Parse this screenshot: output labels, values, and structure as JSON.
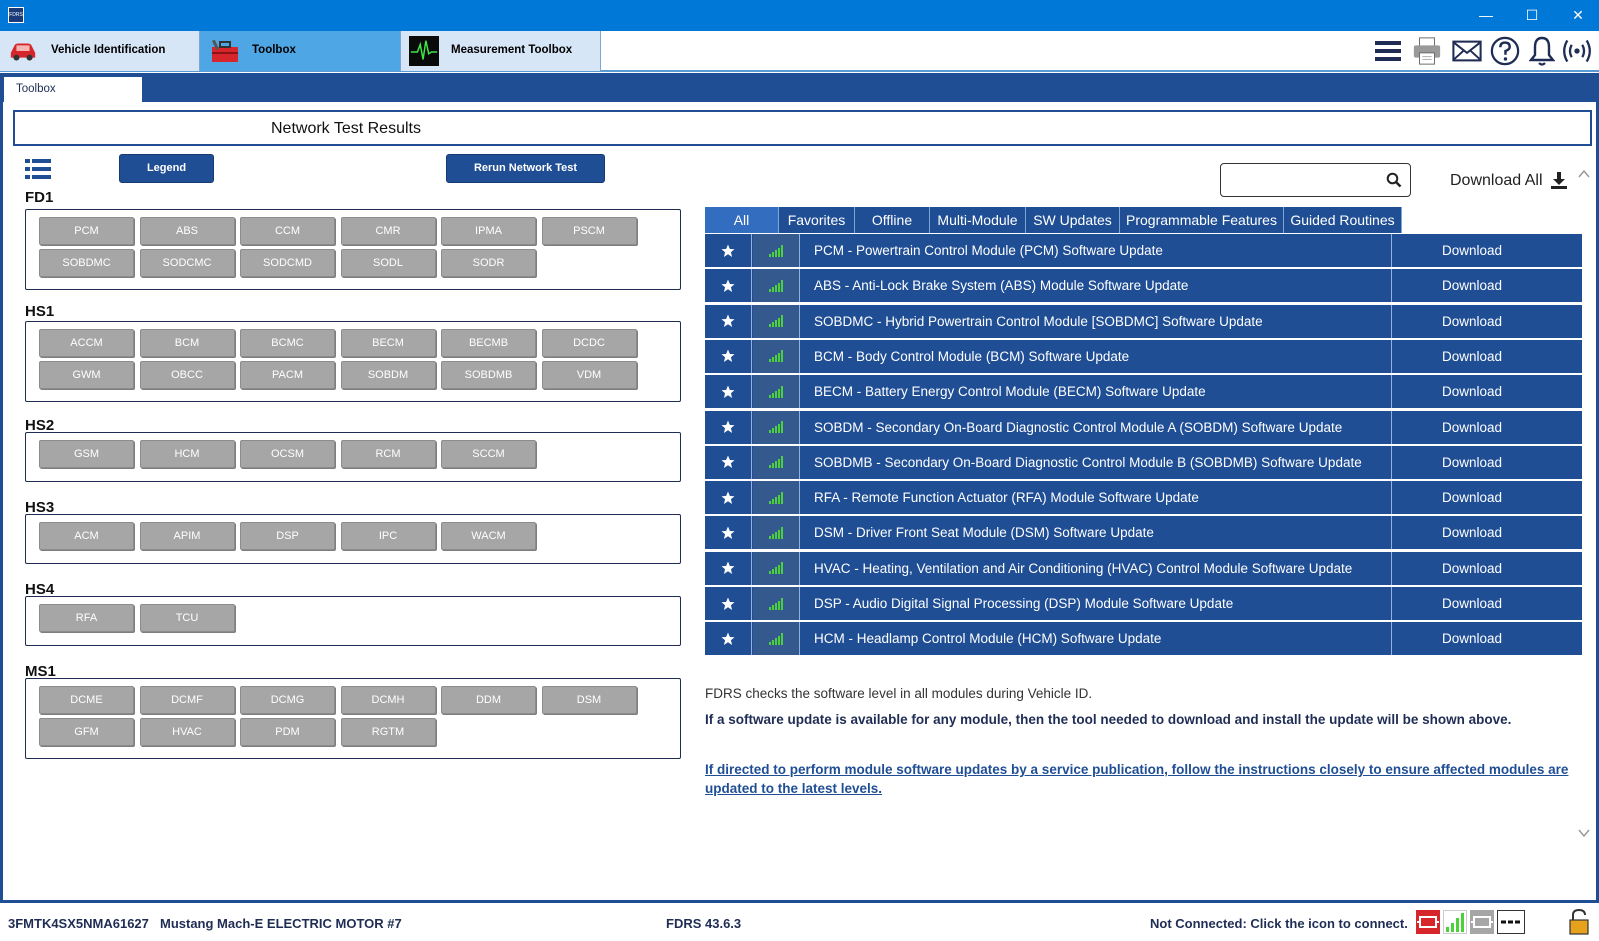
{
  "titlebar": {
    "app_icon": "fdrs-logo-icon",
    "minimize": "—",
    "maximize": "☐",
    "close": "✕"
  },
  "main_tabs": [
    {
      "label": "Vehicle Identification",
      "icon": "car-icon"
    },
    {
      "label": "Toolbox",
      "icon": "toolbox-icon"
    },
    {
      "label": "Measurement Toolbox",
      "icon": "oscilloscope-icon"
    }
  ],
  "toolbar_icons": [
    "menu-icon",
    "printer-icon",
    "mail-icon",
    "help-icon",
    "bell-icon",
    "wireless-icon"
  ],
  "sub_tab": "Toolbox",
  "panel_title": "Network Test Results",
  "buttons": {
    "legend": "Legend",
    "rerun": "Rerun Network Test"
  },
  "groups": [
    {
      "name": "FD1",
      "rows": [
        [
          "PCM",
          "ABS",
          "CCM",
          "CMR",
          "IPMA",
          "PSCM"
        ],
        [
          "SOBDMC",
          "SODCMC",
          "SODCMD",
          "SODL",
          "SODR"
        ]
      ]
    },
    {
      "name": "HS1",
      "rows": [
        [
          "ACCM",
          "BCM",
          "BCMC",
          "BECM",
          "BECMB",
          "DCDC"
        ],
        [
          "GWM",
          "OBCC",
          "PACM",
          "SOBDM",
          "SOBDMB",
          "VDM"
        ]
      ]
    },
    {
      "name": "HS2",
      "rows": [
        [
          "GSM",
          "HCM",
          "OCSM",
          "RCM",
          "SCCM"
        ]
      ]
    },
    {
      "name": "HS3",
      "rows": [
        [
          "ACM",
          "APIM",
          "DSP",
          "IPC",
          "WACM"
        ]
      ]
    },
    {
      "name": "HS4",
      "rows": [
        [
          "RFA",
          "TCU"
        ]
      ]
    },
    {
      "name": "MS1",
      "rows": [
        [
          "DCME",
          "DCMF",
          "DCMG",
          "DCMH",
          "DDM",
          "DSM"
        ],
        [
          "GFM",
          "HVAC",
          "PDM",
          "RGTM"
        ]
      ]
    }
  ],
  "search": {
    "placeholder": "",
    "value": ""
  },
  "download_all": "Download All",
  "filter_tabs": [
    "All",
    "Favorites",
    "Offline",
    "Multi-Module",
    "SW Updates",
    "Programmable Features",
    "Guided Routines"
  ],
  "selected_filter": "All",
  "updates": [
    {
      "desc": "PCM - Powertrain Control Module (PCM) Software Update",
      "action": "Download"
    },
    {
      "desc": "ABS - Anti-Lock Brake System (ABS) Module Software Update",
      "action": "Download"
    },
    {
      "desc": "SOBDMC - Hybrid Powertrain Control Module [SOBDMC] Software Update",
      "action": "Download"
    },
    {
      "desc": "BCM - Body Control Module (BCM) Software Update",
      "action": "Download"
    },
    {
      "desc": "BECM - Battery Energy Control Module (BECM) Software Update",
      "action": "Download"
    },
    {
      "desc": "SOBDM - Secondary On-Board Diagnostic Control Module A (SOBDM) Software Update",
      "action": "Download"
    },
    {
      "desc": "SOBDMB - Secondary On-Board Diagnostic Control Module B (SOBDMB) Software Update",
      "action": "Download"
    },
    {
      "desc": "RFA - Remote Function Actuator (RFA) Module Software Update",
      "action": "Download"
    },
    {
      "desc": "DSM - Driver Front Seat Module (DSM) Software Update",
      "action": "Download"
    },
    {
      "desc": "HVAC - Heating, Ventilation and Air Conditioning (HVAC) Control Module Software Update",
      "action": "Download"
    },
    {
      "desc": "DSP - Audio Digital Signal Processing (DSP) Module Software Update",
      "action": "Download"
    },
    {
      "desc": "HCM - Headlamp Control Module (HCM) Software Update",
      "action": "Download"
    }
  ],
  "info": {
    "line1": "FDRS checks the software level in all modules during Vehicle ID.",
    "line2": "If a software update is available for any module, then the tool needed to download and install the update will be shown above.",
    "line3": "If directed to perform module software updates by a service publication, follow the instructions closely to ensure affected modules are updated to the latest levels."
  },
  "status": {
    "vin": "3FMTK4SX5NMA61627",
    "vehicle": "Mustang Mach-E ELECTRIC MOTOR #7",
    "version": "FDRS 43.6.3",
    "connection": "Not Connected: Click the icon to connect."
  },
  "colors": {
    "accent": "#1f4e95",
    "title_bar": "#0078d7",
    "module_button": "#a6a6a6",
    "signal": "#4cd13b"
  }
}
